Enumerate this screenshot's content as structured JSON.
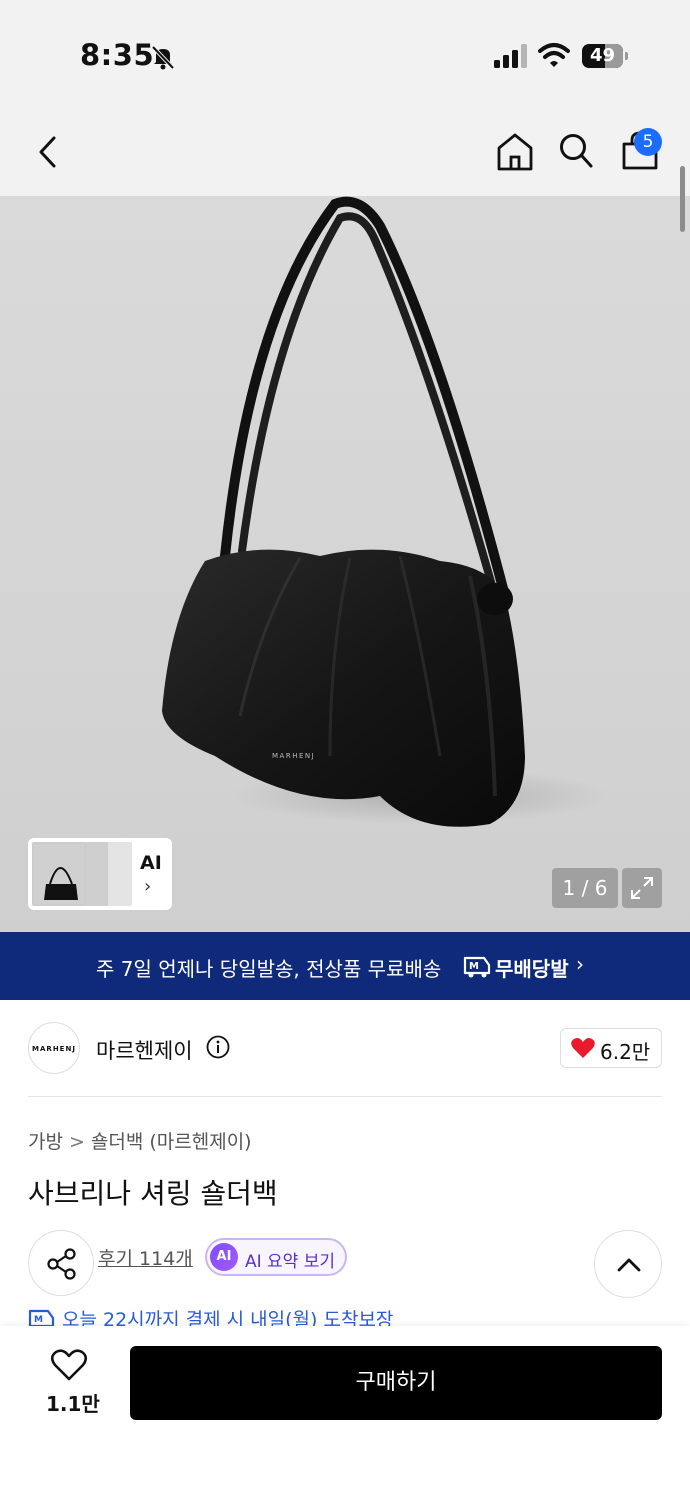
{
  "status_bar": {
    "time": "8:35",
    "battery": "49"
  },
  "nav": {
    "cart_count": "5"
  },
  "gallery": {
    "ai_label": "AI",
    "ai_chevron": "›",
    "counter": "1 / 6",
    "bag_logo": "MARHENJ",
    "icons": [
      "bell-off-icon",
      "signal-icon",
      "wifi-icon",
      "back-icon",
      "home-icon",
      "search-icon",
      "cart-icon",
      "expand-icon"
    ]
  },
  "banner": {
    "text": "주 7일 언제나 당일발송, 전상품 무료배송",
    "brand": "무배당발",
    "chevron": "›",
    "color": "#0f2a7a"
  },
  "brand": {
    "avatar_text": "MARHENJ",
    "name": "마르헨제이",
    "likes": "6.2만"
  },
  "product": {
    "breadcrumb": [
      "가방",
      "숄더백 (마르헨제이)"
    ],
    "breadcrumb_sep": ">",
    "title": "사브리나 셔링 숄더백",
    "reviews": "후기 114개",
    "ai_badge": "AI",
    "ai_summary": "AI 요약 보기",
    "delivery": "오늘 22시까지 결제 시 내일(월) 도착보장"
  },
  "bottom": {
    "wish_count": "1.1만",
    "buy_label": "구매하기"
  }
}
